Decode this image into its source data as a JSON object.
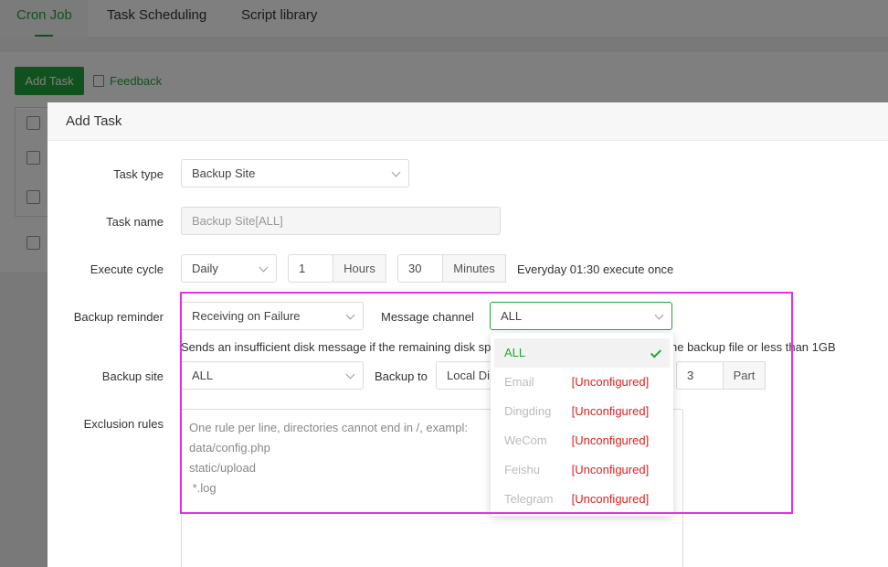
{
  "tabs": [
    "Cron Job",
    "Task Scheduling",
    "Script library"
  ],
  "toolbar": {
    "add_task": "Add Task",
    "feedback": "Feedback"
  },
  "modal": {
    "title": "Add Task",
    "task_type": {
      "label": "Task type",
      "value": "Backup Site"
    },
    "task_name": {
      "label": "Task name",
      "value": "Backup Site[ALL]"
    },
    "execute_cycle": {
      "label": "Execute cycle",
      "period": "Daily",
      "hours_value": "1",
      "hours_unit": "Hours",
      "minutes_value": "30",
      "minutes_unit": "Minutes",
      "summary": "Everyday 01:30 execute once"
    },
    "backup_reminder": {
      "label": "Backup reminder",
      "value": "Receiving on Failure"
    },
    "message_channel": {
      "label": "Message channel",
      "value": "ALL"
    },
    "disk_note_left": "Sends an insufficient disk message if the remaining disk spa",
    "disk_note_right": "he backup file or less than 1GB",
    "backup_site": {
      "label": "Backup site",
      "value": "ALL"
    },
    "backup_to": {
      "label": "Backup to",
      "value": "Local Di"
    },
    "keep": {
      "value": "3",
      "unit": "Part"
    },
    "exclusion": {
      "label": "Exclusion rules",
      "placeholder_lines": [
        "One rule per line, directories cannot end in /, exampl:",
        "data/config.php",
        "static/upload",
        " *.log"
      ]
    }
  },
  "dropdown": {
    "items": [
      {
        "name": "ALL",
        "status": "",
        "selected": true
      },
      {
        "name": "Email",
        "status": "[Unconfigured]",
        "selected": false
      },
      {
        "name": "Dingding",
        "status": "[Unconfigured]",
        "selected": false
      },
      {
        "name": "WeCom",
        "status": "[Unconfigured]",
        "selected": false
      },
      {
        "name": "Feishu",
        "status": "[Unconfigured]",
        "selected": false
      },
      {
        "name": "Telegram",
        "status": "[Unconfigured]",
        "selected": false
      }
    ]
  },
  "colors": {
    "accent": "#20a53a",
    "error": "#e02020",
    "highlight": "#e530e5"
  }
}
